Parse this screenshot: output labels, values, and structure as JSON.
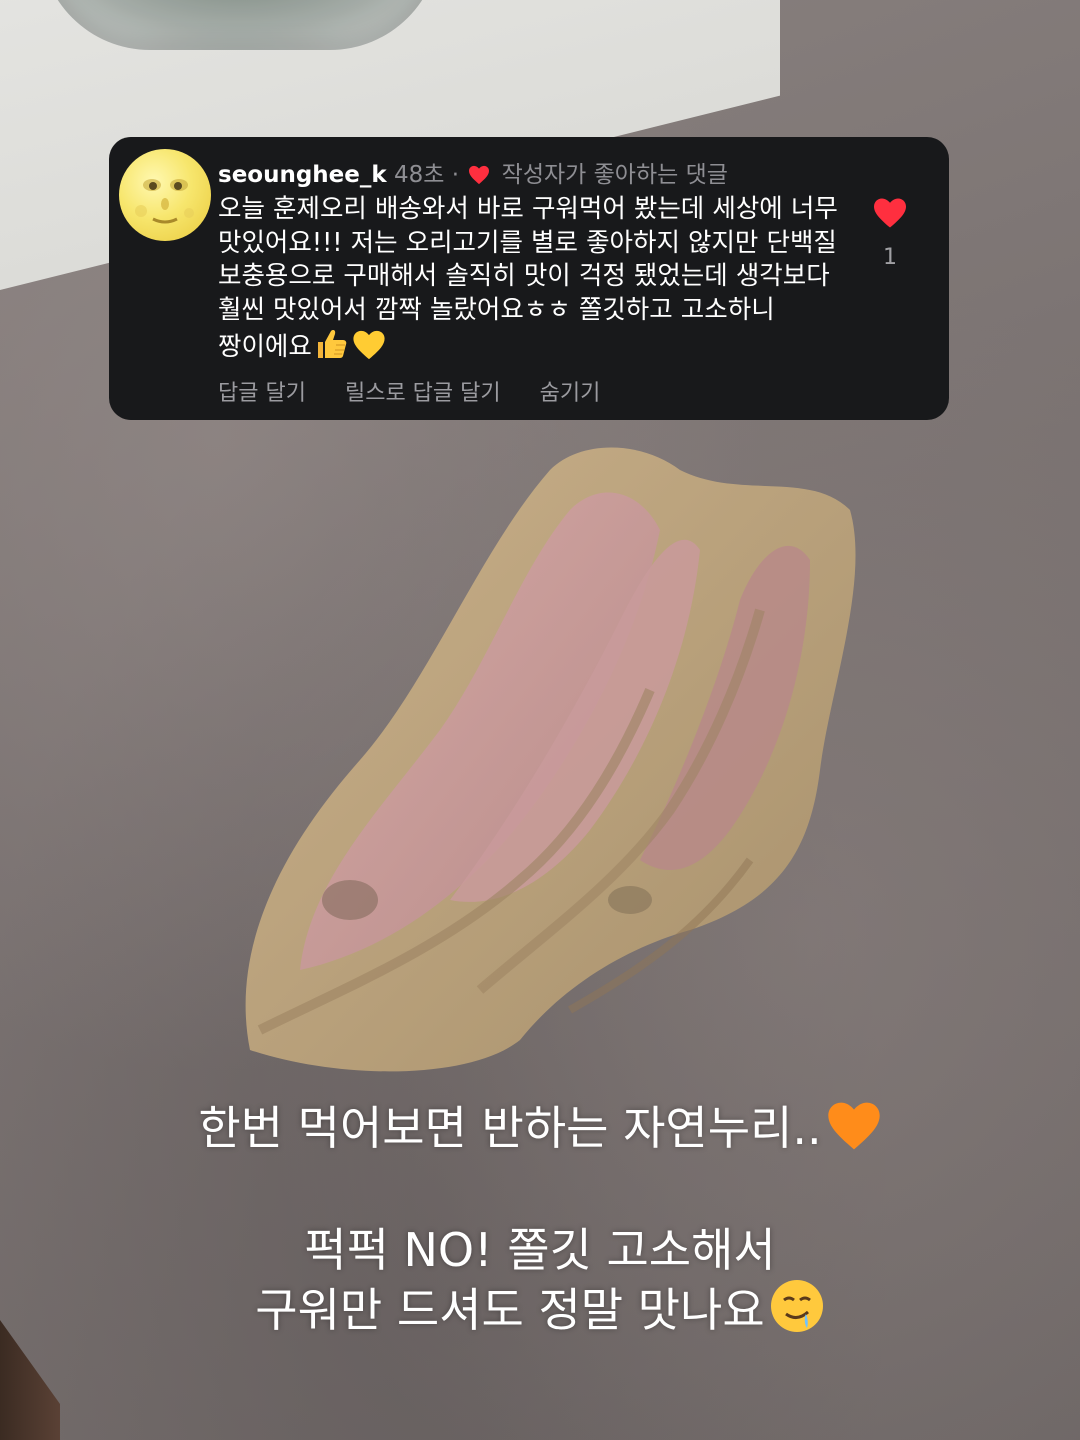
{
  "comment": {
    "username": "seounghee_k",
    "time": "48초",
    "separator": "·",
    "author_liked_label": "작성자가 좋아하는 댓글",
    "text": "오늘 훈제오리 배송와서 바로 구워먹어 봤는데 세상에 너무 맛있어요!!! 저는 오리고기를 별로 좋아하지 않지만 단백질 보충용으로 구매해서 솔직히 맛이 걱정 됐었는데 생각보다 훨씬 맛있어서 깜짝 놀랐어요ㅎㅎ 쫄깃하고 고소하니 짱이에요",
    "like_count": "1",
    "actions": {
      "reply": "답글 달기",
      "reply_with_reels": "릴스로 답글 달기",
      "hide": "숨기기"
    }
  },
  "captions": {
    "line1": "한번 먹어보면 반하는 자연누리..",
    "line2": "퍽퍽 NO! 쫄깃 고소해서",
    "line3": "구워만 드셔도 정말 맛나요"
  },
  "icons": {
    "avatar": "full-moon-face-emoji",
    "author_heart": "red-heart-icon",
    "like": "red-heart-icon",
    "thumbs_up": "thumbs-up-emoji",
    "yellow_heart": "yellow-heart-emoji",
    "orange_heart": "orange-heart-emoji",
    "drooling": "drooling-face-emoji"
  },
  "colors": {
    "card_bg": "#18191b",
    "heart_red": "#ff2f3f",
    "text_primary": "#ffffff",
    "text_secondary": "#8e8e93"
  }
}
